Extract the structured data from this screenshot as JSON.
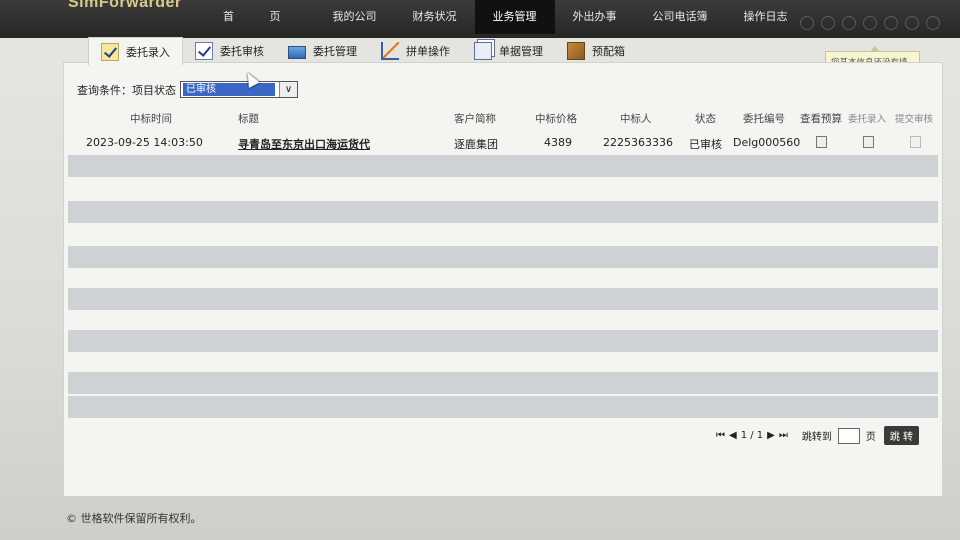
{
  "app": {
    "logo": "SimForwarder"
  },
  "nav": [
    {
      "label": "首 页"
    },
    {
      "label": "我的公司"
    },
    {
      "label": "财务状况"
    },
    {
      "label": "业务管理",
      "active": true
    },
    {
      "label": "外出办事"
    },
    {
      "label": "公司电话簿"
    },
    {
      "label": "操作日志"
    }
  ],
  "tooltip": {
    "text": "您基本信息还没有填写，请填写！"
  },
  "tabs": [
    {
      "label": "委托录入",
      "icon": "checkbox-yellow-icon",
      "active": true
    },
    {
      "label": "委托审核",
      "icon": "checkbox-blue-icon"
    },
    {
      "label": "委托管理",
      "icon": "monitor-icon"
    },
    {
      "label": "拼单操作",
      "icon": "chart-icon"
    },
    {
      "label": "单据管理",
      "icon": "documents-icon"
    },
    {
      "label": "预配箱",
      "icon": "box-icon"
    }
  ],
  "filter": {
    "label": "查询条件：项目状态",
    "selected": "已审核"
  },
  "table": {
    "headers": [
      "中标时间",
      "标题",
      "客户简称",
      "中标价格",
      "中标人",
      "状态",
      "委托编号",
      "查看预算",
      "委托录入",
      "提交审核"
    ],
    "rows": [
      {
        "time": "2023-09-25 14:03:50",
        "title": "寻青岛至东京出口海运货代",
        "customer": "逐鹿集团",
        "price": "4389",
        "winner": "2225363336",
        "status": "已审核",
        "order_no": "Delg000560"
      }
    ]
  },
  "pager": {
    "page": "1 / 1",
    "jump_label": "跳转到",
    "unit": "页",
    "go": "跳 转"
  },
  "footer": {
    "text": "© 世格软件保留所有权利。"
  }
}
